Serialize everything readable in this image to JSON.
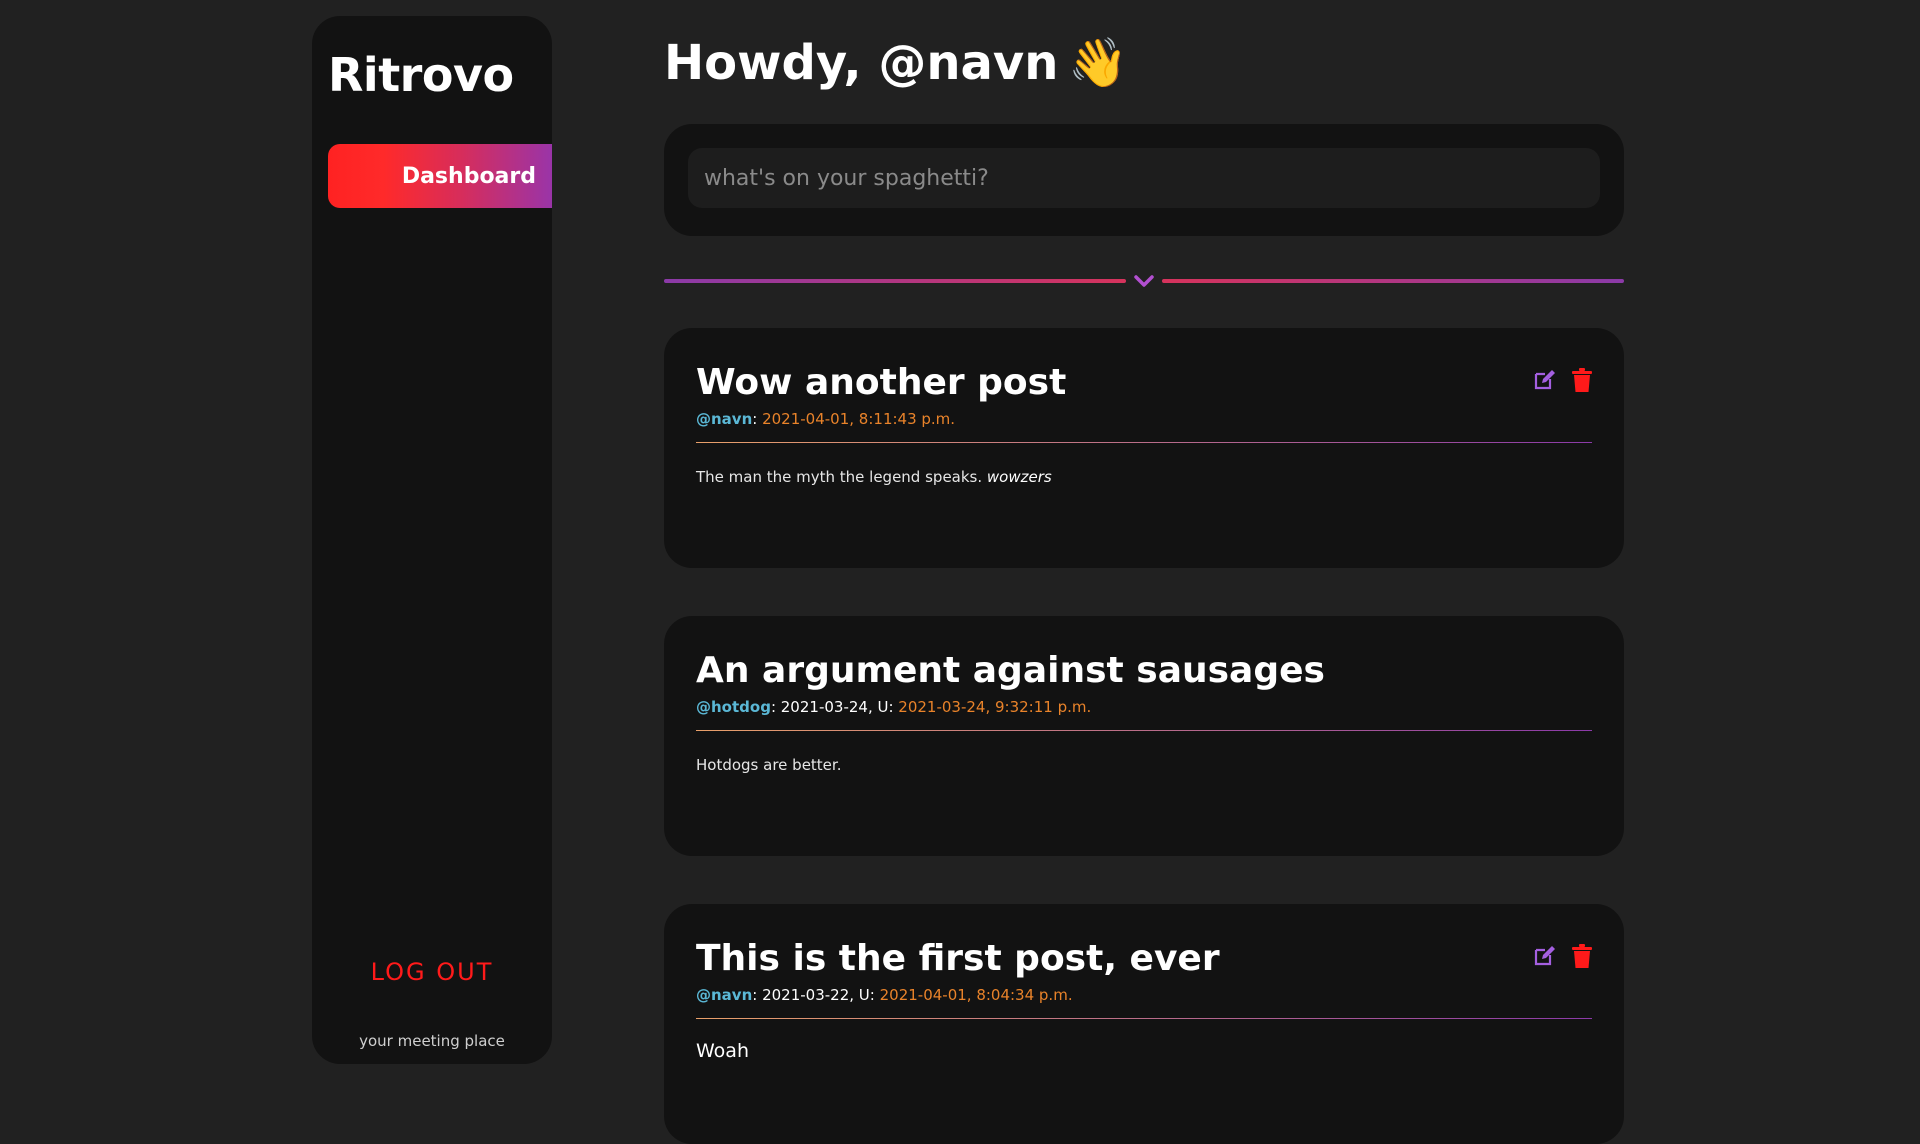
{
  "app": {
    "brand": "Ritrovo",
    "tagline": "your meeting place"
  },
  "sidebar": {
    "items": [
      {
        "label": "Dashboard",
        "active": true
      }
    ],
    "logout_label": "LOG OUT"
  },
  "header": {
    "greeting": "Howdy, @navn",
    "wave_icon": "waving-hand-icon",
    "wave_glyph": "👋"
  },
  "composer": {
    "placeholder": "what's on your spaghetti?",
    "value": ""
  },
  "divider": {
    "icon": "chevron-down-icon"
  },
  "posts": [
    {
      "title": "Wow another post",
      "author": "@navn",
      "created": "",
      "updated_prefix": "",
      "updated": "2021-04-01, 8:11:43 p.m.",
      "body_plain": "The man the myth the legend speaks. ",
      "body_emphasis": "wowzers",
      "editable": true
    },
    {
      "title": "An argument against sausages",
      "author": "@hotdog",
      "created": "2021-03-24, U: ",
      "updated": "2021-03-24, 9:32:11 p.m.",
      "body_plain": "Hotdogs are better.",
      "editable": false
    },
    {
      "title": "This is the first post, ever",
      "author": "@navn",
      "created": "2021-03-22, U: ",
      "updated": "2021-04-01, 8:04:34 p.m.",
      "body_heading": "Woah",
      "editable": true
    }
  ],
  "colors": {
    "background": "#212121",
    "panel": "#121212",
    "accent_red": "#ff1a1a",
    "accent_purple": "#9a34a8",
    "author": "#5bb8d6",
    "date": "#e9832a",
    "edit_icon": "#a45fe0",
    "delete_icon": "#ff1a1a"
  }
}
